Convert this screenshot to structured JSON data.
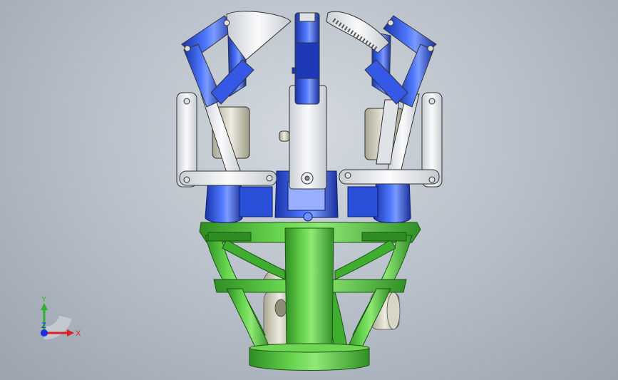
{
  "triad": {
    "x_label": "X",
    "y_label": "Y",
    "z_label": "Z"
  },
  "colors": {
    "background": "#b4bcc6",
    "arm_blue": "#2a4fd8",
    "arm_white": "#e8ecef",
    "base_green": "#4fc13a",
    "x_axis": "#e02020",
    "y_axis": "#2fb02f",
    "z_axis": "#2030e0"
  },
  "icons": {
    "triad": "xyz-triad-icon",
    "model": "gripper-assembly-icon"
  }
}
